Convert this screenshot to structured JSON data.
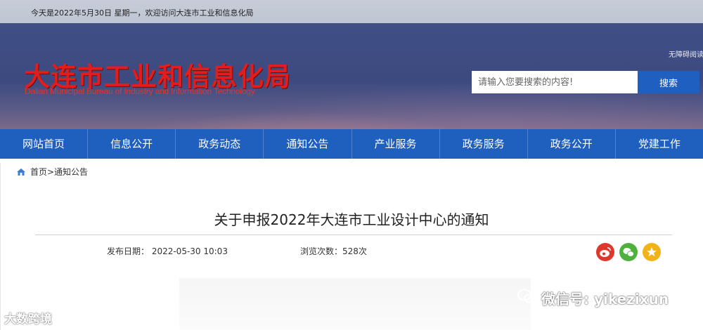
{
  "topbar": {
    "welcome": "今天是2022年5月30日 星期一，欢迎访问大连市工业和信息化局"
  },
  "header": {
    "logo_cn": "大连市工业和信息化局",
    "logo_en": "Dalian Municipal Bureau of Industry and Information Technology",
    "accessibility_link": "无障碍阅读",
    "search": {
      "placeholder": "请输入您要搜索的内容!",
      "button": "搜索"
    }
  },
  "nav": {
    "items": [
      {
        "label": "网站首页"
      },
      {
        "label": "信息公开"
      },
      {
        "label": "政务动态"
      },
      {
        "label": "通知公告"
      },
      {
        "label": "产业服务"
      },
      {
        "label": "政务服务"
      },
      {
        "label": "政务公开"
      },
      {
        "label": "党建工作"
      }
    ]
  },
  "breadcrumb": {
    "text": "首页>通知公告",
    "icon": "home-icon"
  },
  "article": {
    "title": "关于申报2022年大连市工业设计中心的通知",
    "publish_date": "发布日期：  2022-05-30  10:03",
    "views": "浏览次数：528次"
  },
  "share": {
    "icons": [
      "weibo-icon",
      "wechat-icon",
      "favorite-icon"
    ],
    "colors": {
      "weibo": "#e0372c",
      "wechat": "#4fb13d",
      "favorite": "#f2b318"
    }
  },
  "watermarks": {
    "left": "大数跨境",
    "right": "微信号: yikezixun"
  },
  "colors": {
    "nav_bg": "#1f5fbd",
    "logo": "#e11d1d",
    "search_button": "#1e5fbf"
  }
}
